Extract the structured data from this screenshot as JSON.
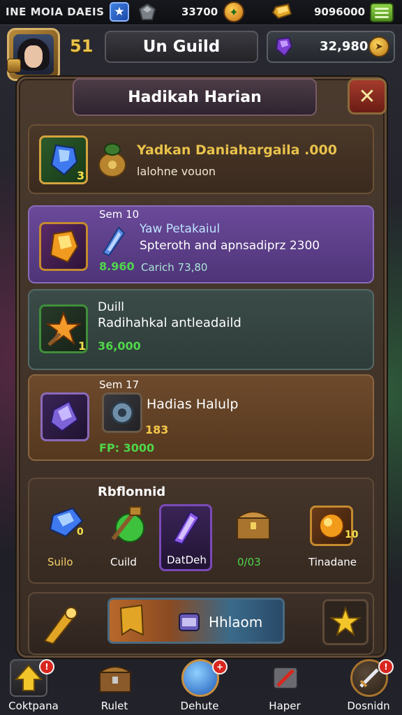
{
  "status_bar": {
    "title": "INE MOIA DAEIS",
    "currency_1": "33700",
    "currency_2": "9096000",
    "blue_icon": "star-icon",
    "menu_icon": "hamburger-menu-icon"
  },
  "header": {
    "level": "51",
    "guild_name": "Un Guild",
    "gems": "32,980"
  },
  "panel": {
    "title": "Hadikah Harian",
    "close_label": "✕"
  },
  "rewards": [
    {
      "badge_count": "3",
      "line1": "Yadkan Daniahargaila .000",
      "line2": "lalohne vouon"
    },
    {
      "tag": "Sem 10",
      "line1": "Yaw Petakaiul",
      "line2": "Spteroth and apnsadiprz 2300",
      "green_value": "8.960",
      "gray_value": "Carich 73,80"
    },
    {
      "tag": "Duill",
      "line1": "Radihahkal antleadaild",
      "badge_count": "1",
      "green_value": "36,000"
    },
    {
      "tag": "Sem 17",
      "line1": "Hadias Halulp",
      "count": "183",
      "green_value": "FP: 3000"
    }
  ],
  "shop": {
    "heading": "Rbflonnid",
    "items": [
      {
        "label": "Suilo",
        "badge": "0"
      },
      {
        "label": "Cuild"
      },
      {
        "label": "DatDeh"
      },
      {
        "label": "0/03"
      },
      {
        "label": "Tinadane",
        "badge": "10"
      }
    ]
  },
  "action": {
    "button_label": "Hhlaom"
  },
  "bottom_nav": [
    {
      "label": "Coktpana",
      "alert": "!"
    },
    {
      "label": "Rulet"
    },
    {
      "label": "Dehute",
      "alert": "+"
    },
    {
      "label": "Haper"
    },
    {
      "label": "Dosnidn",
      "alert": "!"
    }
  ],
  "colors": {
    "gold_text": "#e9c24b",
    "green_value": "#4fd64a",
    "panel_brown": "#3a2d24",
    "purple_card": "#5e3e8a",
    "teal_card": "#344643",
    "orange_card": "#624226"
  }
}
